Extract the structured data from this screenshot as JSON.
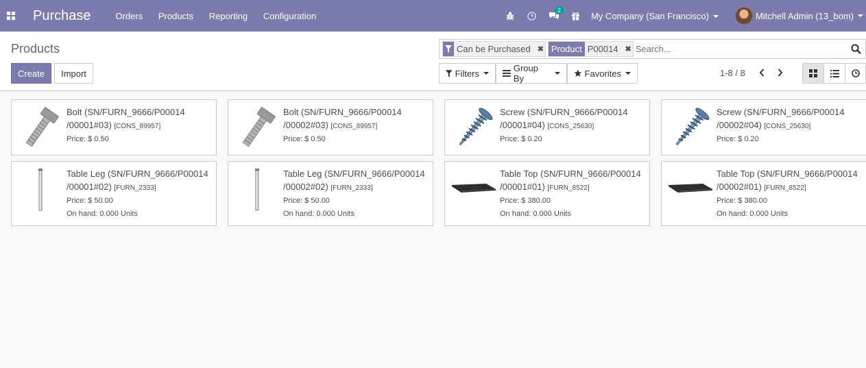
{
  "navbar": {
    "app_name": "Purchase",
    "menu": [
      "Orders",
      "Products",
      "Reporting",
      "Configuration"
    ],
    "chat_count": "2",
    "company": "My Company (San Francisco)",
    "user": "Mitchell Admin (13_bom)",
    "color": "#7c7bad"
  },
  "control": {
    "breadcrumb": "Products",
    "create_label": "Create",
    "import_label": "Import",
    "facets": [
      {
        "category_icon": "filter-icon",
        "values": "Can be Purchased"
      },
      {
        "category": "Product",
        "values": "P00014"
      }
    ],
    "search_placeholder": "Search...",
    "filters_label": "Filters",
    "groupby_label": "Group By",
    "favorites_label": "Favorites",
    "pager": "1-8 / 8"
  },
  "products": [
    {
      "name": "Bolt (SN/FURN_9666/P00014 /00001#03)",
      "code": "[CONS_89957]",
      "price": "Price: $ 0.50",
      "onhand": "",
      "image": "bolt"
    },
    {
      "name": "Bolt (SN/FURN_9666/P00014 /00002#03)",
      "code": "[CONS_89957]",
      "price": "Price: $ 0.50",
      "onhand": "",
      "image": "bolt"
    },
    {
      "name": "Screw (SN/FURN_9666/P00014 /00001#04)",
      "code": "[CONS_25630]",
      "price": "Price: $ 0.20",
      "onhand": "",
      "image": "screw"
    },
    {
      "name": "Screw (SN/FURN_9666/P00014 /00002#04)",
      "code": "[CONS_25630]",
      "price": "Price: $ 0.20",
      "onhand": "",
      "image": "screw"
    },
    {
      "name": "Table Leg (SN/FURN_9666/P00014 /00001#02)",
      "code": "[FURN_2333]",
      "price": "Price: $ 50.00",
      "onhand": "On hand: 0.000 Units",
      "image": "leg"
    },
    {
      "name": "Table Leg (SN/FURN_9666/P00014 /00002#02)",
      "code": "[FURN_2333]",
      "price": "Price: $ 50.00",
      "onhand": "On hand: 0.000 Units",
      "image": "leg"
    },
    {
      "name": "Table Top (SN/FURN_9666/P00014 /00001#01)",
      "code": "[FURN_8522]",
      "price": "Price: $ 380.00",
      "onhand": "On hand: 0.000 Units",
      "image": "top"
    },
    {
      "name": "Table Top (SN/FURN_9666/P00014 /00002#01)",
      "code": "[FURN_8522]",
      "price": "Price: $ 380.00",
      "onhand": "On hand: 0.000 Units",
      "image": "top"
    }
  ]
}
